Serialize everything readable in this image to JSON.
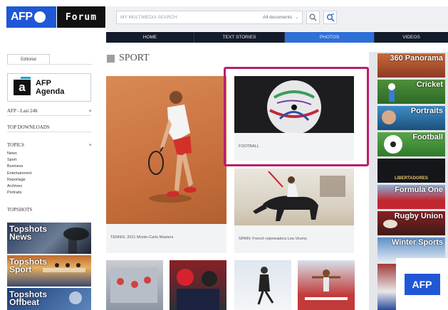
{
  "header": {
    "logo_text": "AFP",
    "forum_label": "Forum",
    "search_placeholder": "MY MULTIMEDIA SEARCH",
    "search_scope": "All documents"
  },
  "nav": [
    "HOME",
    "TEXT STORIES",
    "PHOTOS",
    "VIDEOS"
  ],
  "nav_active": "PHOTOS",
  "sidebar": {
    "tab": "Editorial",
    "agenda_line1": "AFP",
    "agenda_line2": "Agenda",
    "afp_last": "AFP - Last 24h",
    "top_downloads": "TOP DOWNLOADS",
    "topics_title": "TOPICS",
    "topics": [
      "News",
      "Sport",
      "Business",
      "Entertainment",
      "Reportage",
      "Archives",
      "Portraits"
    ],
    "topshots_title": "TOPSHOTS",
    "topshots": [
      {
        "line1": "Topshots",
        "line2": "News"
      },
      {
        "line1": "Topshots",
        "line2": "Sport"
      },
      {
        "line1": "Topshots",
        "line2": "Offbeat"
      }
    ]
  },
  "main": {
    "section_title": "SPORT",
    "cards": [
      {
        "caption": "TENNIS: 2021 Monte-Carlo Masters"
      },
      {
        "caption": "FOOTBALL"
      },
      {
        "caption": "SPAIN: French rejoneadora Lea Vicens"
      }
    ]
  },
  "right_tiles": [
    {
      "label": "360 Panorama"
    },
    {
      "label": "Cricket"
    },
    {
      "label": "Portraits"
    },
    {
      "label": "Football"
    },
    {
      "label": "",
      "logo": "LIBERTADORES"
    },
    {
      "label": "Formula One"
    },
    {
      "label": "Rugby Union"
    },
    {
      "label": "Winter Sports"
    }
  ],
  "overlay_logo": "AFP",
  "colors": {
    "brand_blue": "#1f57d6",
    "nav_dark": "#141c2b",
    "highlight": "#b8206a"
  }
}
